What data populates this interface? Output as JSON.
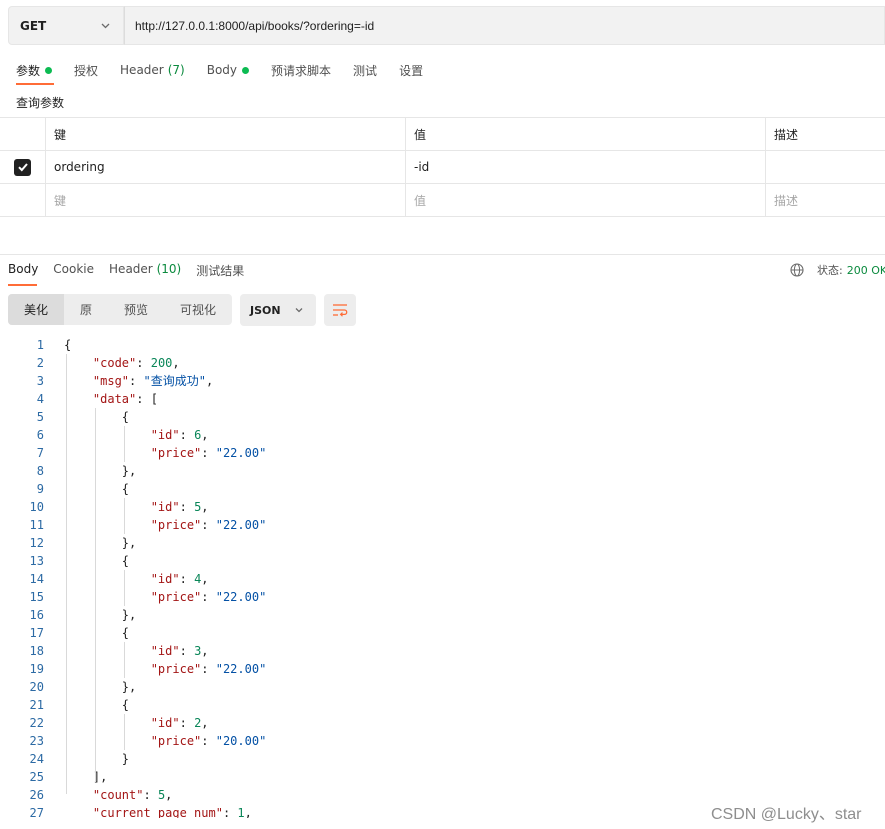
{
  "request": {
    "method": "GET",
    "url": "http://127.0.0.1:8000/api/books/?ordering=-id"
  },
  "request_tabs": [
    {
      "label": "参数",
      "dot": true
    },
    {
      "label": "授权"
    },
    {
      "label": "Header",
      "count": "(7)"
    },
    {
      "label": "Body",
      "dot": true
    },
    {
      "label": "预请求脚本"
    },
    {
      "label": "测试"
    },
    {
      "label": "设置"
    }
  ],
  "params": {
    "section_label": "查询参数",
    "headers": [
      "键",
      "值",
      "描述"
    ],
    "rows": [
      {
        "key": "ordering",
        "value": "-id",
        "description": "",
        "checked": true
      }
    ],
    "placeholders": {
      "key": "键",
      "value": "值",
      "description": "描述"
    }
  },
  "response_tabs": [
    {
      "label": "Body"
    },
    {
      "label": "Cookie"
    },
    {
      "label": "Header",
      "count": "(10)"
    },
    {
      "label": "测试结果"
    }
  ],
  "status": {
    "label": "状态:",
    "code": "200 OK"
  },
  "view_modes": [
    "美化",
    "原",
    "预览",
    "可视化"
  ],
  "format": "JSON",
  "code_lines": [
    "{",
    "    \"code\": 200,",
    "    \"msg\": \"查询成功\",",
    "    \"data\": [",
    "        {",
    "            \"id\": 6,",
    "            \"price\": \"22.00\"",
    "        },",
    "        {",
    "            \"id\": 5,",
    "            \"price\": \"22.00\"",
    "        },",
    "        {",
    "            \"id\": 4,",
    "            \"price\": \"22.00\"",
    "        },",
    "        {",
    "            \"id\": 3,",
    "            \"price\": \"22.00\"",
    "        },",
    "        {",
    "            \"id\": 2,",
    "            \"price\": \"20.00\"",
    "        }",
    "    ],",
    "    \"count\": 5,",
    "    \"current_page_num\": 1,"
  ],
  "watermark": "CSDN @Lucky、star",
  "colors": {
    "accent": "#ff6c37",
    "success": "#0cbb52"
  }
}
